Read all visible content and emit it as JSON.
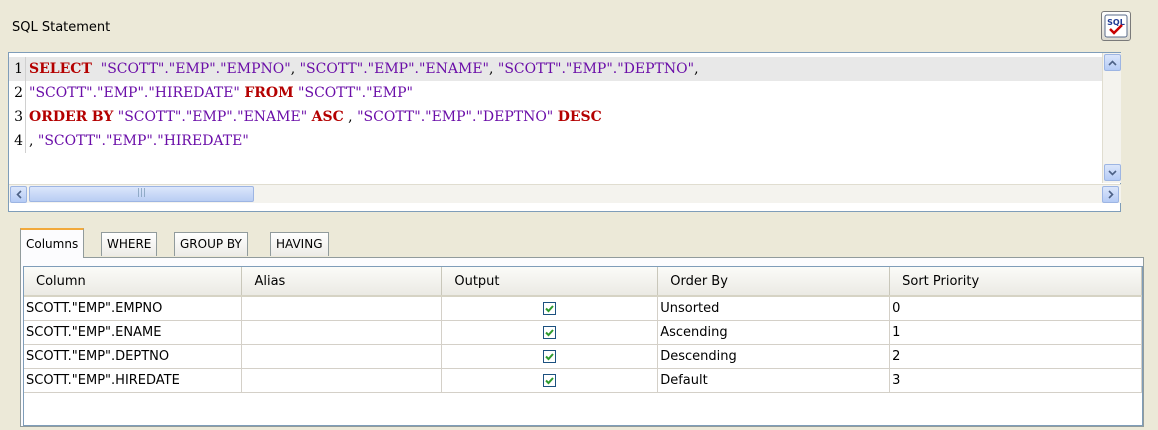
{
  "sql_panel": {
    "title": "SQL Statement",
    "check_button": "sql-check-icon",
    "lines": [
      {
        "n": "1",
        "tokens": [
          {
            "t": "SELECT",
            "c": "kw"
          },
          {
            "t": "  ",
            "c": "plain"
          },
          {
            "t": "\"SCOTT\".\"EMP\".\"EMPNO\"",
            "c": "str"
          },
          {
            "t": ", ",
            "c": "plain"
          },
          {
            "t": "\"SCOTT\".\"EMP\".\"ENAME\"",
            "c": "str"
          },
          {
            "t": ", ",
            "c": "plain"
          },
          {
            "t": "\"SCOTT\".\"EMP\".\"DEPTNO\"",
            "c": "str"
          },
          {
            "t": ",",
            "c": "plain"
          }
        ]
      },
      {
        "n": "2",
        "tokens": [
          {
            "t": "\"SCOTT\".\"EMP\".\"HIREDATE\"",
            "c": "str"
          },
          {
            "t": " ",
            "c": "plain"
          },
          {
            "t": "FROM",
            "c": "kw"
          },
          {
            "t": " ",
            "c": "plain"
          },
          {
            "t": "\"SCOTT\".\"EMP\"",
            "c": "str"
          }
        ]
      },
      {
        "n": "3",
        "tokens": [
          {
            "t": "ORDER",
            "c": "kw"
          },
          {
            "t": " ",
            "c": "plain"
          },
          {
            "t": "BY",
            "c": "kw"
          },
          {
            "t": " ",
            "c": "plain"
          },
          {
            "t": "\"SCOTT\".\"EMP\".\"ENAME\"",
            "c": "str"
          },
          {
            "t": " ",
            "c": "plain"
          },
          {
            "t": "ASC",
            "c": "kw"
          },
          {
            "t": " , ",
            "c": "plain"
          },
          {
            "t": "\"SCOTT\".\"EMP\".\"DEPTNO\"",
            "c": "str"
          },
          {
            "t": " ",
            "c": "plain"
          },
          {
            "t": "DESC",
            "c": "kw"
          }
        ]
      },
      {
        "n": "4",
        "tokens": [
          {
            "t": ", ",
            "c": "plain"
          },
          {
            "t": "\"SCOTT\".\"EMP\".\"HIREDATE\"",
            "c": "str"
          }
        ]
      }
    ]
  },
  "tabs": [
    {
      "label": "Columns",
      "active": true
    },
    {
      "label": "WHERE",
      "active": false
    },
    {
      "label": "GROUP BY",
      "active": false
    },
    {
      "label": "HAVING",
      "active": false
    }
  ],
  "grid": {
    "columns": [
      "Column",
      "Alias",
      "Output",
      "Order By",
      "Sort Priority"
    ],
    "rows": [
      {
        "column": "SCOTT.\"EMP\".EMPNO",
        "alias": "",
        "output": true,
        "order_by": "Unsorted",
        "priority": "0"
      },
      {
        "column": "SCOTT.\"EMP\".ENAME",
        "alias": "",
        "output": true,
        "order_by": "Ascending",
        "priority": "1"
      },
      {
        "column": "SCOTT.\"EMP\".DEPTNO",
        "alias": "",
        "output": true,
        "order_by": "Descending",
        "priority": "2"
      },
      {
        "column": "SCOTT.\"EMP\".HIREDATE",
        "alias": "",
        "output": true,
        "order_by": "Default",
        "priority": "3"
      }
    ]
  },
  "colors": {
    "keyword": "#b40000",
    "identifier": "#6a0da8",
    "check": "#2e9a2e",
    "active_tab_accent": "#f2a93b"
  }
}
